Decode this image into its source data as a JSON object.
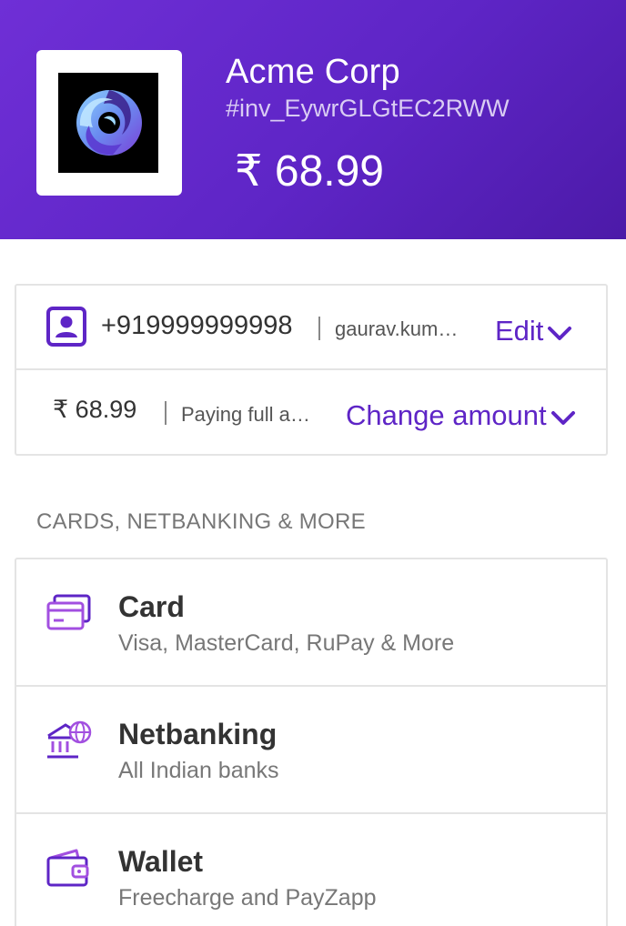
{
  "header": {
    "merchant_name": "Acme Corp",
    "invoice_id": "#inv_EywrGLGtEC2RWW",
    "amount": "₹ 68.99",
    "logo_icon": "swirl-logo-icon"
  },
  "contact": {
    "phone": "+919999999998",
    "email": "gaurav.kumar@example.com",
    "edit_label": "Edit"
  },
  "amount_row": {
    "amount": "₹ 68.99",
    "note": "Paying full amount",
    "change_label": "Change amount"
  },
  "section_title": "CARDS, NETBANKING & MORE",
  "methods": [
    {
      "title": "Card",
      "subtitle": "Visa, MasterCard, RuPay & More",
      "icon": "card-icon"
    },
    {
      "title": "Netbanking",
      "subtitle": "All Indian banks",
      "icon": "bank-icon"
    },
    {
      "title": "Wallet",
      "subtitle": "Freecharge and PayZapp",
      "icon": "wallet-icon"
    }
  ],
  "colors": {
    "brand": "#5e25c6",
    "header_gradient_start": "#6f2fd6",
    "header_gradient_end": "#4c1aa8"
  }
}
